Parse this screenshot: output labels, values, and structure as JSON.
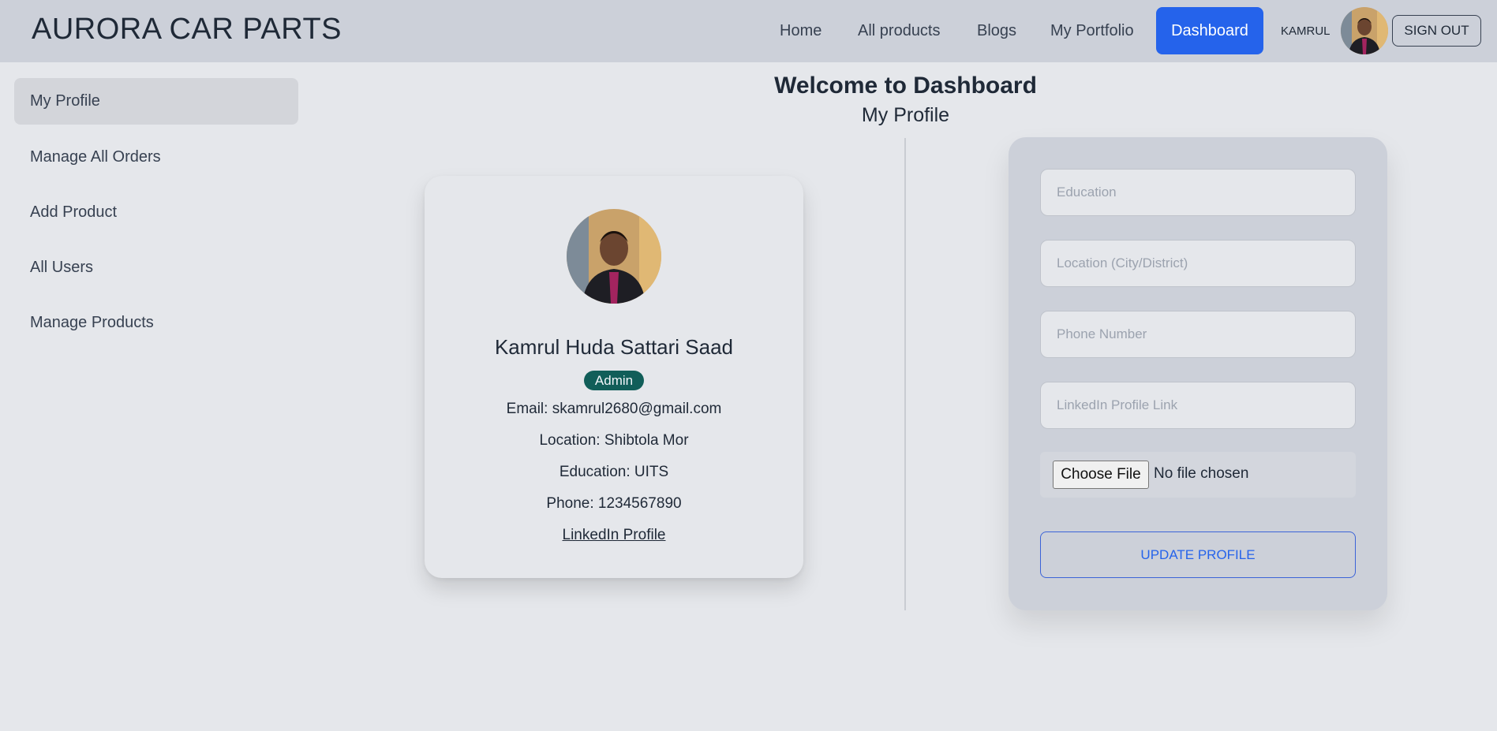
{
  "nav": {
    "brand": "AURORA CAR PARTS",
    "links": [
      "Home",
      "All products",
      "Blogs",
      "My Portfolio"
    ],
    "active": "Dashboard",
    "user": "KAMRUL",
    "sign_out": "SIGN OUT"
  },
  "sidebar": {
    "items": [
      {
        "label": "My Profile",
        "active": true
      },
      {
        "label": "Manage All Orders"
      },
      {
        "label": "Add Product"
      },
      {
        "label": "All Users"
      },
      {
        "label": "Manage Products"
      }
    ]
  },
  "main": {
    "title": "Welcome to Dashboard",
    "subtitle": "My Profile"
  },
  "profile": {
    "name": "Kamrul Huda Sattari Saad",
    "role": "Admin",
    "email": "Email: skamrul2680@gmail.com",
    "location": "Location: Shibtola Mor",
    "education": "Education: UITS",
    "phone": "Phone: 1234567890",
    "linkedin": "LinkedIn Profile"
  },
  "form": {
    "education_placeholder": "Education",
    "location_placeholder": "Location (City/District)",
    "phone_placeholder": "Phone Number",
    "linkedin_placeholder": "LinkedIn Profile Link",
    "choose_file": "Choose File",
    "no_file": "No file chosen",
    "update": "UPDATE PROFILE"
  },
  "colors": {
    "accent": "#2563eb",
    "badge": "#115e59",
    "navbar": "#ccd0d9",
    "background": "#e5e7eb"
  }
}
